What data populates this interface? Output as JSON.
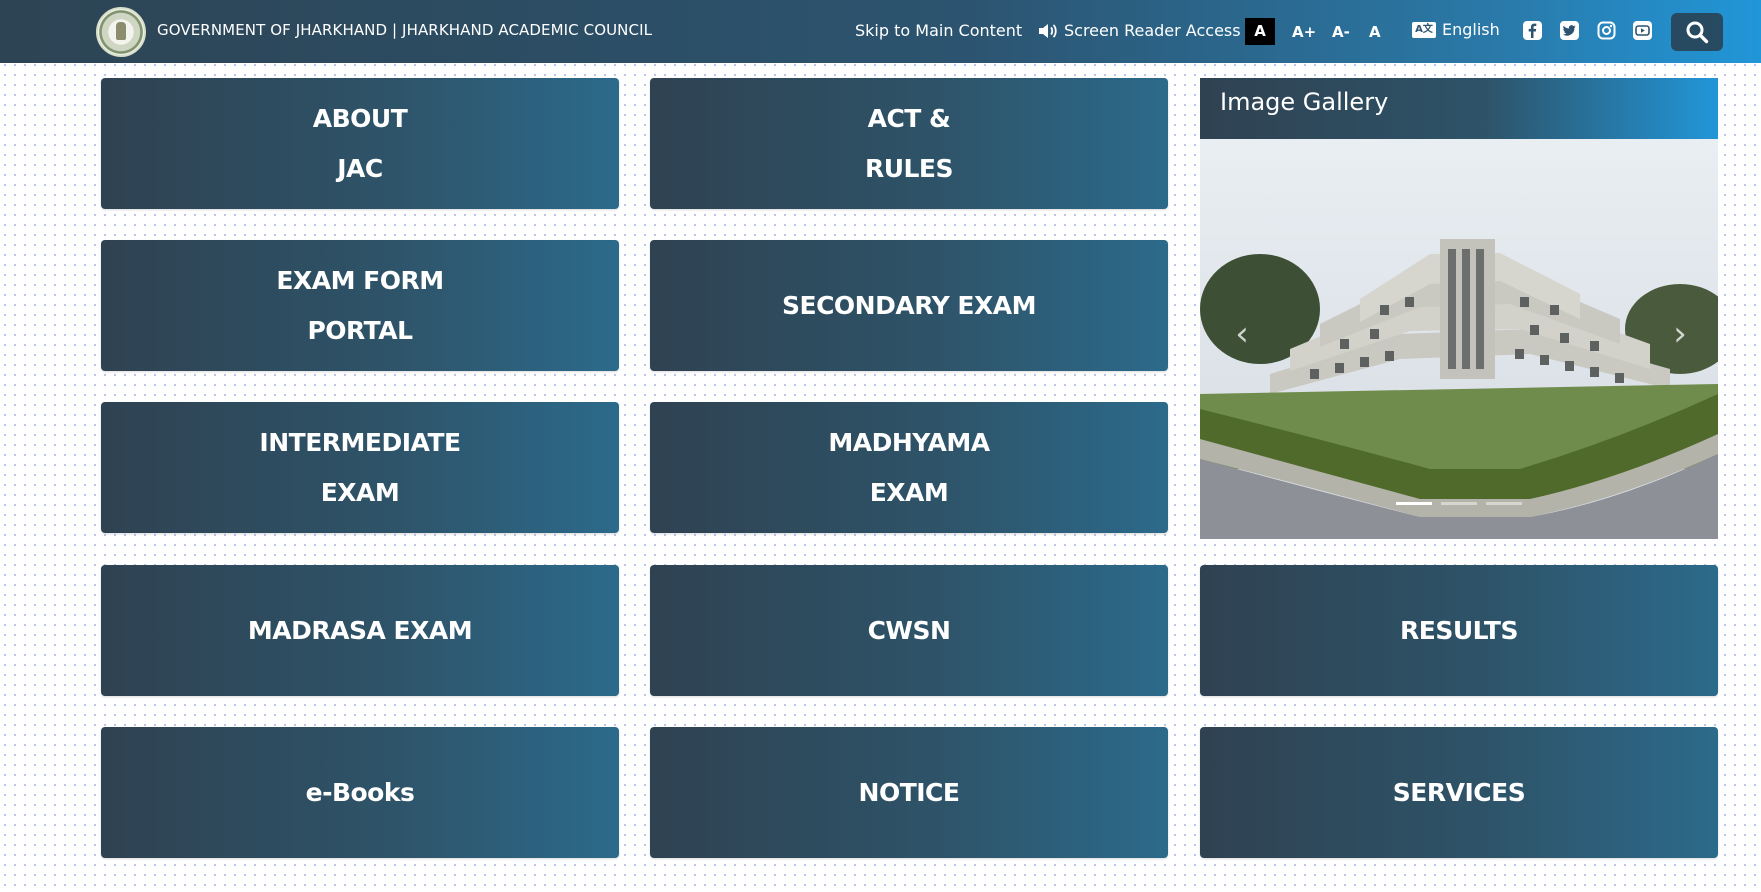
{
  "header": {
    "title": "GOVERNMENT OF JHARKHAND | JHARKHAND ACADEMIC COUNCIL",
    "skip_link": "Skip to Main Content",
    "screen_reader": "Screen Reader Access",
    "font_sizes": [
      "A",
      "A+",
      "A-",
      "A"
    ],
    "language": "English",
    "language_icon": "A文",
    "social_icons": [
      "facebook-icon",
      "twitter-icon",
      "instagram-icon",
      "youtube-icon"
    ],
    "search_icon": "search-icon",
    "gradient_colors": [
      "#2d4454",
      "#2196d8"
    ]
  },
  "tiles": [
    {
      "lines": [
        "ABOUT",
        "JAC"
      ]
    },
    {
      "lines": [
        "ACT &",
        "RULES"
      ]
    },
    {
      "lines": [
        "EXAM FORM",
        "PORTAL"
      ]
    },
    {
      "lines": [
        "SECONDARY EXAM"
      ]
    },
    {
      "lines": [
        "INTERMEDIATE",
        "EXAM"
      ]
    },
    {
      "lines": [
        "MADHYAMA",
        "EXAM"
      ]
    },
    {
      "lines": [
        "MADRASA EXAM"
      ]
    },
    {
      "lines": [
        "CWSN"
      ]
    },
    {
      "lines": [
        "RESULTS"
      ]
    },
    {
      "lines": [
        "e-Books"
      ]
    },
    {
      "lines": [
        "NOTICE"
      ]
    },
    {
      "lines": [
        "SERVICES"
      ]
    }
  ],
  "gallery": {
    "title": "Image Gallery",
    "prev_glyph": "‹",
    "next_glyph": "›",
    "slide_count": 3,
    "active_slide": 1
  },
  "colors": {
    "tile_start": "#2f4252",
    "tile_end": "#2c6a8b",
    "accent": "#2196d8"
  }
}
